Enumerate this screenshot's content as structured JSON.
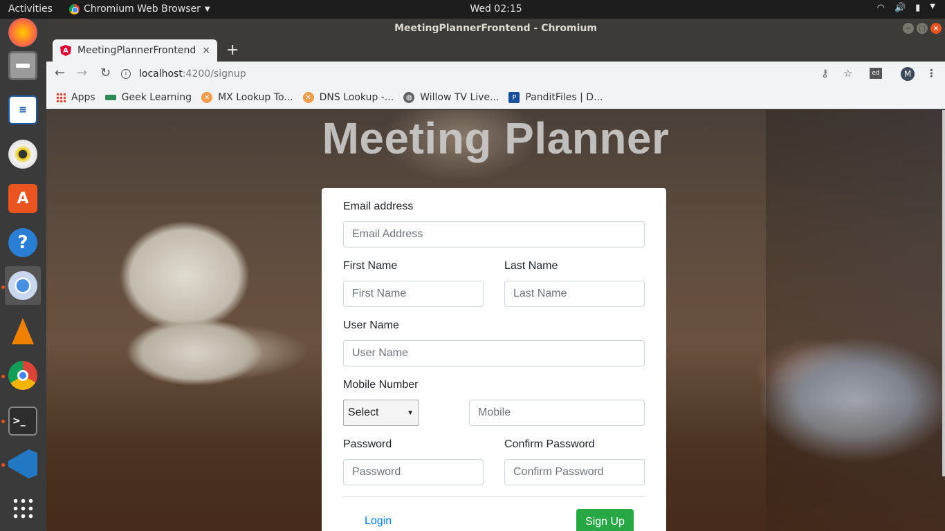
{
  "system": {
    "activities": "Activities",
    "app_menu": "Chromium Web Browser",
    "clock": "Wed 02:15"
  },
  "window": {
    "title": "MeetingPlannerFrontend - Chromium"
  },
  "tab": {
    "title": "MeetingPlannerFrontend",
    "close": "×",
    "new_tab": "+"
  },
  "toolbar": {
    "url_host": "localhost",
    "url_path": ":4200/signup",
    "extension_badge": "ed",
    "avatar_letter": "M"
  },
  "bookmarks": [
    {
      "label": "Apps",
      "icon": "apps-grid-icon"
    },
    {
      "label": "Geek Learning",
      "icon": "geek-learning-icon"
    },
    {
      "label": "MX Lookup To...",
      "icon": "mxtoolbox-icon"
    },
    {
      "label": "DNS Lookup -...",
      "icon": "mxtoolbox-icon"
    },
    {
      "label": "Willow TV Live...",
      "icon": "globe-icon"
    },
    {
      "label": "PanditFiles | D...",
      "icon": "panditfiles-icon"
    }
  ],
  "page": {
    "heading": "Meeting Planner"
  },
  "form": {
    "email_label": "Email address",
    "email_placeholder": "Email Address",
    "first_name_label": "First Name",
    "first_name_placeholder": "First Name",
    "last_name_label": "Last Name",
    "last_name_placeholder": "Last Name",
    "username_label": "User Name",
    "username_placeholder": "User Name",
    "mobile_label": "Mobile Number",
    "country_code_selected": "Select",
    "mobile_placeholder": "Mobile",
    "password_label": "Password",
    "password_placeholder": "Password",
    "confirm_label": "Confirm Password",
    "confirm_placeholder": "Confirm Password",
    "login_link": "Login",
    "signup_button": "Sign Up"
  },
  "colors": {
    "accent_link": "#007bff",
    "signup_green": "#28a745",
    "ubuntu_orange": "#e95420"
  }
}
